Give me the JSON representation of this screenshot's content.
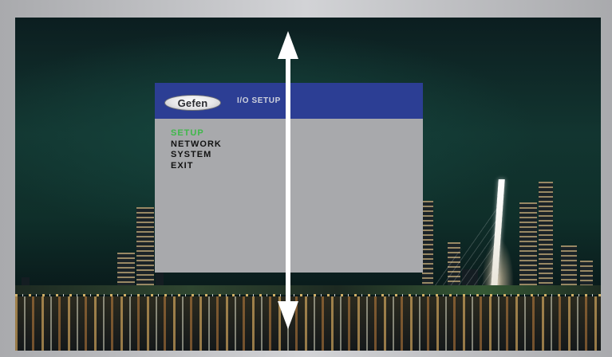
{
  "osd": {
    "logo_text": "Gefen",
    "title": "I/O SETUP",
    "menu": [
      {
        "label": "SETUP",
        "active": true
      },
      {
        "label": "NETWORK",
        "active": false
      },
      {
        "label": "SYSTEM",
        "active": false
      },
      {
        "label": "EXIT",
        "active": false
      }
    ],
    "active_color": "#3fb84a",
    "header_color": "#2c3e94",
    "panel_color": "#a8a9ac"
  },
  "overlay": {
    "icon": "vertical-double-arrow-icon",
    "color": "#ffffff"
  }
}
